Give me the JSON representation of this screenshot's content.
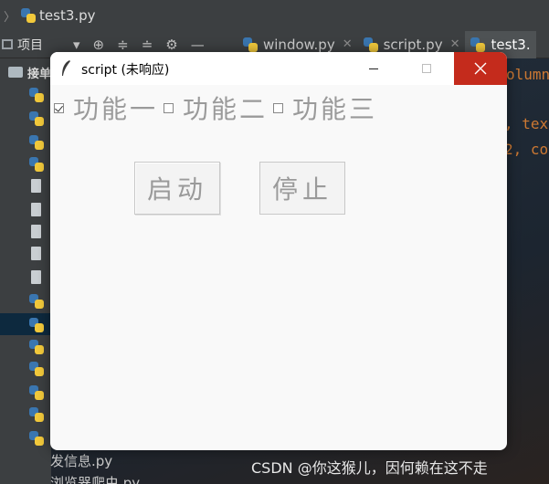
{
  "ide": {
    "title": "test3.py",
    "project_label": "项目",
    "tabs": [
      {
        "label": "window.py"
      },
      {
        "label": "script.py"
      },
      {
        "label": "test3."
      }
    ],
    "sidebar_head": "接单",
    "code_fragments": [
      "olumn",
      ", tex",
      "2, co"
    ],
    "bottom_files": [
      "发信息.py",
      "浏览器爬虫.py"
    ],
    "watermark": "CSDN @你这猴儿，因何赖在这不走"
  },
  "window": {
    "title": "script (未响应)",
    "checkboxes": [
      {
        "label": "功能一",
        "checked": true
      },
      {
        "label": "功能二",
        "checked": false
      },
      {
        "label": "功能三",
        "checked": false
      }
    ],
    "start_label": "启动",
    "stop_label": "停止"
  },
  "colors": {
    "close_button": "#c42b1c",
    "disabled_text": "#9a9a9a",
    "code_orange": "#cc7832"
  }
}
